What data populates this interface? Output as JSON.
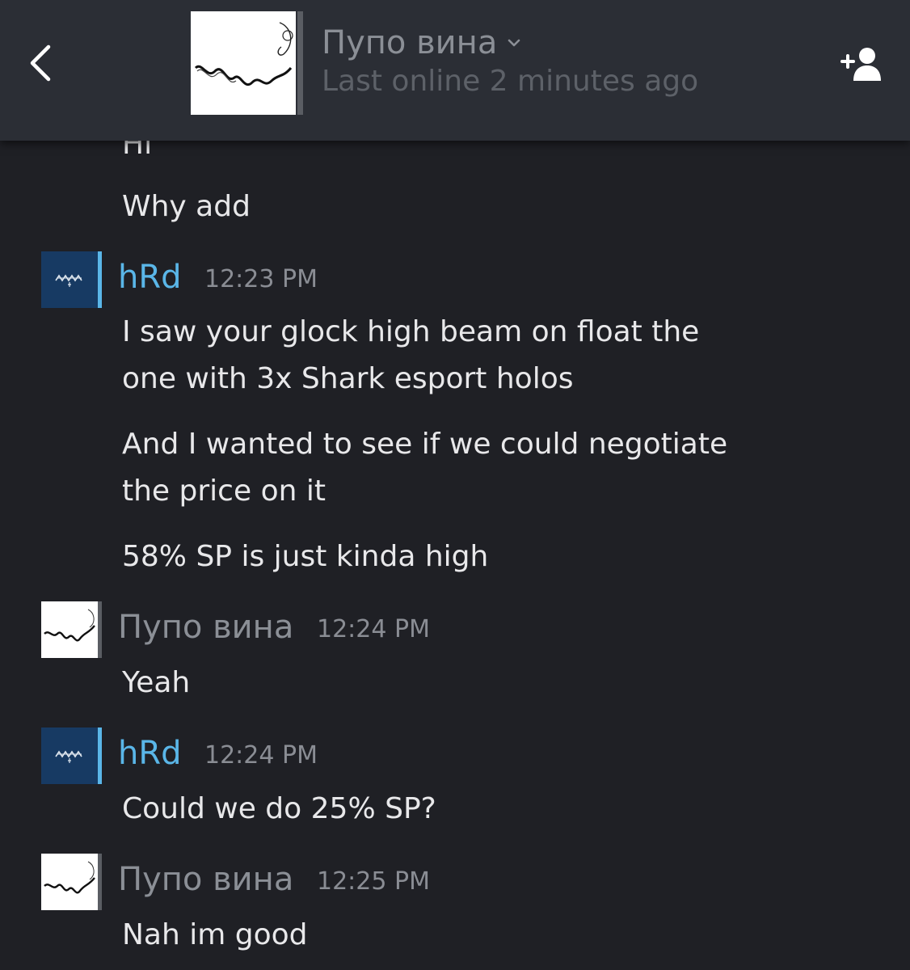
{
  "header": {
    "name": "Пупо вина",
    "status": "Last online 2 minutes ago",
    "back_icon": "chevron-left-icon",
    "add_icon": "add-friend-icon"
  },
  "colors": {
    "background": "#1f2025",
    "header": "#2b2e35",
    "self_name": "#5ab6e8",
    "friend_name_offline": "#8b8f96",
    "text": "#e8e8ea",
    "timestamp": "#8a8d94",
    "self_bar": "#5ab6e8",
    "friend_bar": "#5a5d63"
  },
  "messages": {
    "m0": "Hi",
    "m1": "Why add",
    "g1": {
      "author": "hRd",
      "time": "12:23 PM",
      "l1": "I saw your glock high beam on float the",
      "l2": "one with 3x Shark esport holos",
      "l3": "And I wanted to see if we could negotiate",
      "l4": "the price on it",
      "l5": "58% SP is just kinda high"
    },
    "g2": {
      "author": "Пупо вина",
      "time": "12:24 PM",
      "l1": "Yeah"
    },
    "g3": {
      "author": "hRd",
      "time": "12:24 PM",
      "l1": "Could we do 25% SP?"
    },
    "g4": {
      "author": "Пупо вина",
      "time": "12:25 PM",
      "l1": "Nah im good"
    }
  }
}
